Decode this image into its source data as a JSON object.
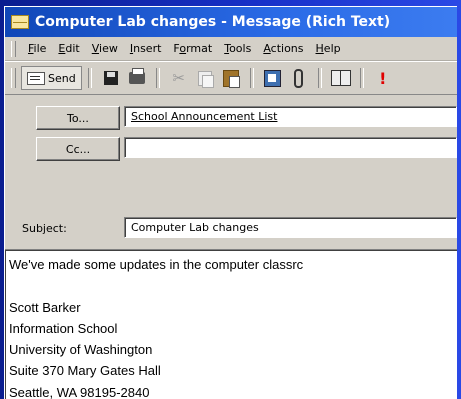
{
  "window": {
    "title": "Computer Lab changes - Message (Rich Text)"
  },
  "menubar": {
    "items": [
      {
        "pre": "",
        "key": "F",
        "post": "ile"
      },
      {
        "pre": "",
        "key": "E",
        "post": "dit"
      },
      {
        "pre": "",
        "key": "V",
        "post": "iew"
      },
      {
        "pre": "",
        "key": "I",
        "post": "nsert"
      },
      {
        "pre": "F",
        "key": "o",
        "post": "rmat"
      },
      {
        "pre": "",
        "key": "T",
        "post": "ools"
      },
      {
        "pre": "",
        "key": "A",
        "post": "ctions"
      },
      {
        "pre": "",
        "key": "H",
        "post": "elp"
      }
    ]
  },
  "toolbar": {
    "send_label": "Send",
    "icons": [
      "save-icon",
      "print-icon",
      "cut-icon",
      "copy-icon",
      "paste-icon",
      "address-book-icon",
      "attach-icon",
      "check-names-icon",
      "importance-icon"
    ]
  },
  "header": {
    "to_button": "To...",
    "to_value": "School Announcement List",
    "cc_button": "Cc...",
    "cc_value": "",
    "subject_label": "Subject:",
    "subject_value": "Computer Lab changes"
  },
  "body": {
    "lines": [
      "We've made some updates in the computer classrc",
      "",
      "Scott Barker",
      "Information School",
      "University of Washington",
      "Suite 370 Mary Gates Hall",
      "Seattle, WA 98195-2840"
    ]
  }
}
